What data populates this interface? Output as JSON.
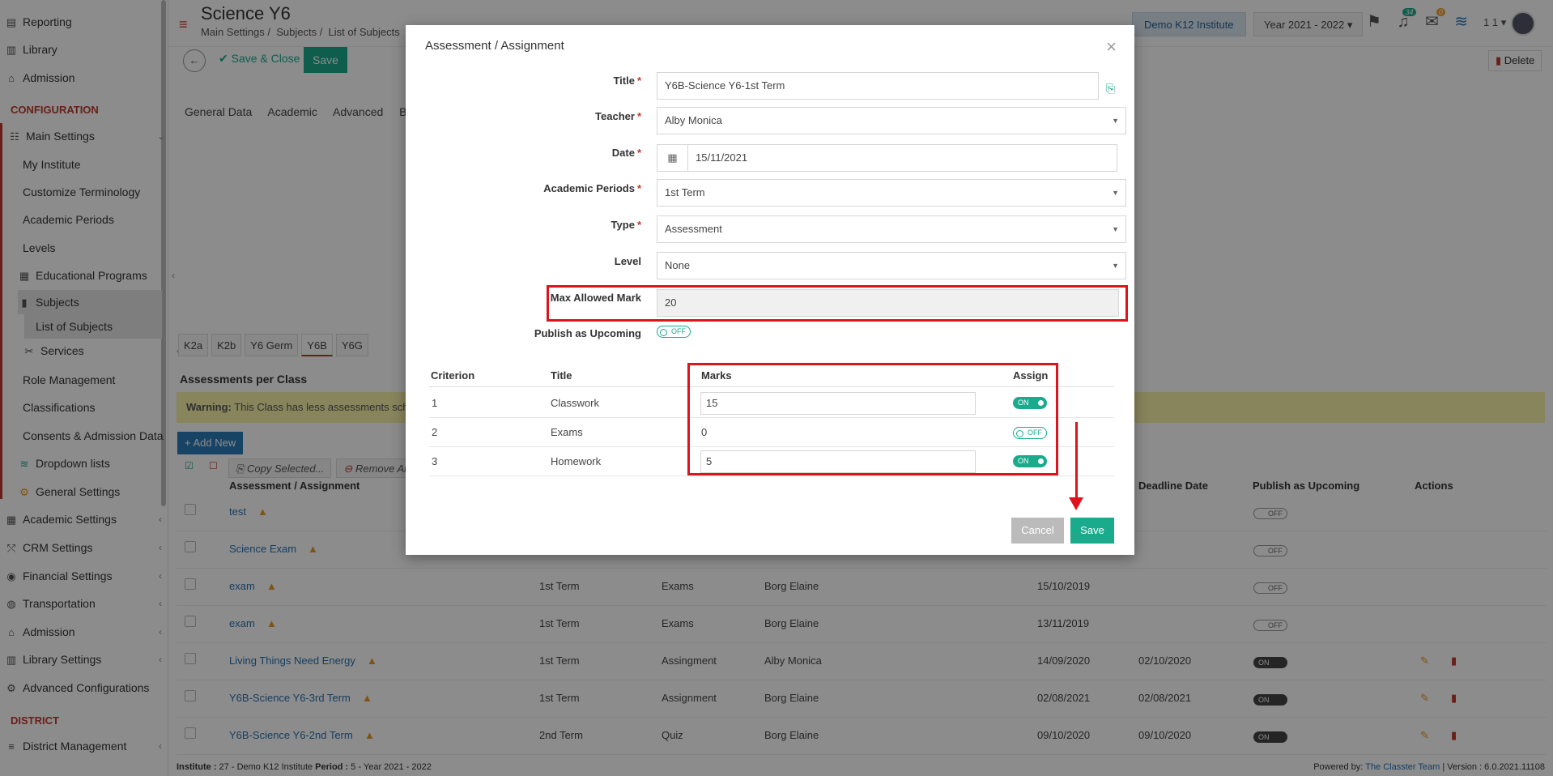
{
  "sidebar": {
    "items_top": [
      {
        "label": "Reporting",
        "icon": "report-icon"
      },
      {
        "label": "Library",
        "icon": "library-icon"
      },
      {
        "label": "Admission",
        "icon": "bank-icon"
      }
    ],
    "config_heading": "CONFIGURATION",
    "main_settings": "Main Settings",
    "sub_items": [
      "My Institute",
      "Customize Terminology",
      "Academic Periods",
      "Levels"
    ],
    "educational_programs": "Educational Programs",
    "subjects": "Subjects",
    "list_of_subjects": "List of Subjects",
    "services": "Services",
    "sub_items2": [
      "Role Management",
      "Classifications",
      "Consents & Admission Data"
    ],
    "dropdown_lists": "Dropdown lists",
    "general_settings": "General Settings",
    "groups": [
      "Academic Settings",
      "CRM Settings",
      "Financial Settings",
      "Transportation",
      "Admission",
      "Library Settings",
      "Advanced Configurations"
    ],
    "district_heading": "DISTRICT",
    "district_management": "District Management"
  },
  "header": {
    "title": "Science Y6",
    "breadcrumb": [
      "Main Settings",
      "Subjects",
      "List of Subjects"
    ],
    "institute": "Demo K12 Institute",
    "year": "Year 2021 - 2022",
    "notif_count": "34",
    "mail_count": "0",
    "user": "1 1"
  },
  "toolbar": {
    "save_close": "Save & Close",
    "save": "Save",
    "delete": "Delete"
  },
  "tabs": [
    "General Data",
    "Academic",
    "Advanced",
    "Billi"
  ],
  "class_tabs": [
    "K2a",
    "K2b",
    "Y6 Germ",
    "Y6B",
    "Y6G"
  ],
  "section_title": "Assessments per Class",
  "warning": {
    "bold": "Warning:",
    "text": " This Class has less assessments sche"
  },
  "add_new": "Add New",
  "bulk": {
    "copy": "Copy Selected...",
    "remove": "Remove All"
  },
  "table": {
    "headers": {
      "assessment": "Assessment / Assignment",
      "deadline": "Deadline Date",
      "publish": "Publish as Upcoming",
      "actions": "Actions"
    },
    "rows": [
      {
        "name": "test",
        "period": "",
        "type": "",
        "teacher": "",
        "date": "",
        "deadline": "",
        "publish": "OFF"
      },
      {
        "name": "Science Exam",
        "period": "",
        "type": "",
        "teacher": "",
        "date": "",
        "deadline": "",
        "publish": "OFF"
      },
      {
        "name": "exam",
        "period": "1st Term",
        "type": "Exams",
        "teacher": "Borg Elaine",
        "date": "15/10/2019",
        "deadline": "",
        "publish": "OFF"
      },
      {
        "name": "exam",
        "period": "1st Term",
        "type": "Exams",
        "teacher": "Borg Elaine",
        "date": "13/11/2019",
        "deadline": "",
        "publish": "OFF"
      },
      {
        "name": "Living Things Need Energy",
        "period": "1st Term",
        "type": "Assingment",
        "teacher": "Alby Monica",
        "date": "14/09/2020",
        "deadline": "02/10/2020",
        "publish": "ON"
      },
      {
        "name": "Y6B-Science Y6-3rd Term",
        "period": "1st Term",
        "type": "Assignment",
        "teacher": "Borg Elaine",
        "date": "02/08/2021",
        "deadline": "02/08/2021",
        "publish": "ON"
      },
      {
        "name": "Y6B-Science Y6-2nd Term",
        "period": "2nd Term",
        "type": "Quiz",
        "teacher": "Borg Elaine",
        "date": "09/10/2020",
        "deadline": "09/10/2020",
        "publish": "ON"
      }
    ]
  },
  "footer": {
    "institute_label": "Institute :",
    "institute_value": " 27 - Demo K12 Institute ",
    "period_label": "Period :",
    "period_value": " 5 - Year 2021 - 2022",
    "powered": "Powered by:",
    "team": "The Classter Team",
    "version": "| Version : 6.0.2021.11108"
  },
  "modal": {
    "title": "Assessment / Assignment",
    "fields": {
      "title_label": "Title",
      "title_value": "Y6B-Science Y6-1st Term",
      "teacher_label": "Teacher",
      "teacher_value": "Alby Monica",
      "date_label": "Date",
      "date_value": "15/11/2021",
      "periods_label": "Academic Periods",
      "periods_value": "1st Term",
      "type_label": "Type",
      "type_value": "Assessment",
      "level_label": "Level",
      "level_value": "None",
      "max_label": "Max Allowed Mark",
      "max_value": "20",
      "publish_label": "Publish as Upcoming",
      "publish_value": "OFF"
    },
    "criteria": {
      "headers": {
        "criterion": "Criterion",
        "title": "Title",
        "marks": "Marks",
        "assign": "Assign"
      },
      "rows": [
        {
          "num": "1",
          "title": "Classwork",
          "marks": "15",
          "assign": "ON"
        },
        {
          "num": "2",
          "title": "Exams",
          "marks": "0",
          "assign": "OFF"
        },
        {
          "num": "3",
          "title": "Homework",
          "marks": "5",
          "assign": "ON"
        }
      ]
    },
    "cancel": "Cancel",
    "save": "Save"
  },
  "colors": {
    "accent": "#1aaa8c",
    "highlight": "#e0121b",
    "config_red": "#c0392b"
  }
}
